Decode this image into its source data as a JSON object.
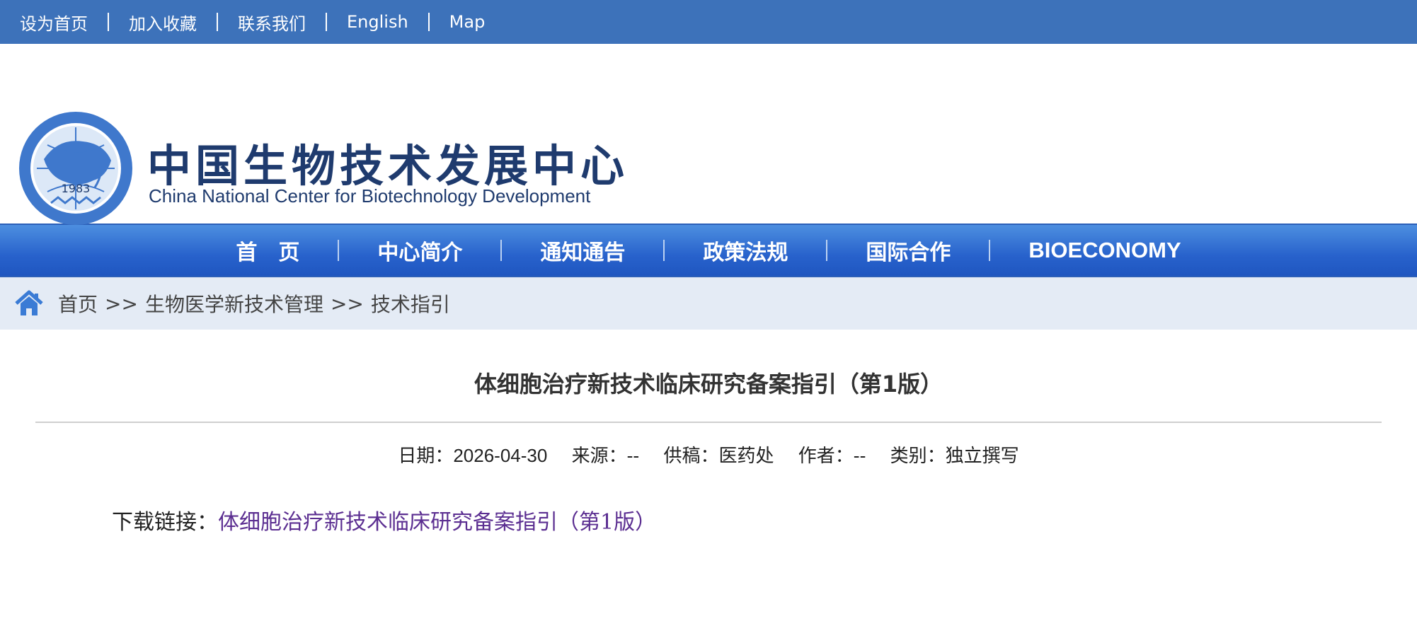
{
  "topbar": {
    "links": [
      "设为首页",
      "加入收藏",
      "联系我们",
      "English",
      "Map"
    ]
  },
  "header": {
    "name_cn": "中国生物技术发展中心",
    "name_en": "China National Center for Biotechnology Development",
    "emblem_year": "1983"
  },
  "nav": {
    "items": [
      "首　页",
      "中心简介",
      "通知通告",
      "政策法规",
      "国际合作",
      "BIOECONOMY"
    ]
  },
  "breadcrumb": {
    "items": [
      "首页",
      "生物医学新技术管理",
      "技术指引"
    ],
    "separator": ">>"
  },
  "article": {
    "title": "体细胞治疗新技术临床研究备案指引（第1版）",
    "meta": {
      "date_label": "日期：",
      "date": "2026-04-30",
      "source_label": "来源：",
      "source": "--",
      "supplier_label": "供稿：",
      "supplier": "医药处",
      "author_label": "作者：",
      "author": "--",
      "category_label": "类别：",
      "category": "独立撰写"
    },
    "download_label": "下载链接：",
    "download_link": "体细胞治疗新技术临床研究备案指引（第1版）"
  },
  "colors": {
    "topbar": "#3d72ba",
    "nav": "#2862cc",
    "breadcrumb_bg": "#e4ebf5",
    "logo_text": "#1f3b6e",
    "link_visited": "#5b2e91"
  }
}
